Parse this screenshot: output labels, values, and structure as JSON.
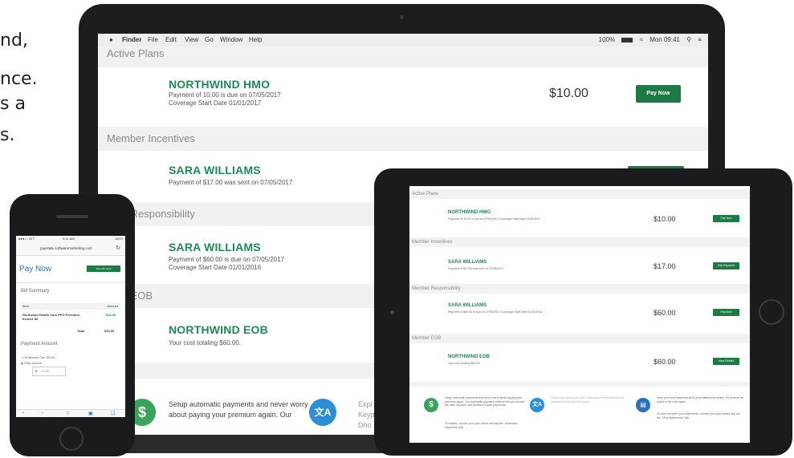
{
  "marketing": {
    "line1": "nd,",
    "line2": "nce.",
    "line3": "s a",
    "line4": "s."
  },
  "colors": {
    "accent": "#1e8a55",
    "button": "#1e7a45",
    "section_bg": "#f1f1f1",
    "device": "#1d1d1f"
  },
  "laptop": {
    "menubar": {
      "apple_icon": "apple-icon",
      "app": "Finder",
      "items": [
        "File",
        "Edit",
        "View",
        "Go",
        "Window",
        "Help"
      ],
      "battery": "100%",
      "clock": "Mon 09:41"
    },
    "sections": {
      "active": "Active Plans",
      "incentives": "Member Incentives",
      "responsibility": "nber Responsibility",
      "eob": "nber EOB"
    },
    "cards": [
      {
        "title": "NORTHWIND HMO",
        "sub1": "Payment of 10.00 is due on 07/05/2017",
        "sub2": "Coverage Start Date 01/01/2017",
        "amount": "$10.00",
        "button": "Pay Now"
      },
      {
        "title": "SARA WILLIAMS",
        "sub1": "Payment of $17.00 was sent on 07/05/2017"
      },
      {
        "title": "SARA WILLIAMS",
        "sub1": "Payment of $60.00 is due on 07/05/2017",
        "sub2": "Coverage Start Date 01/01/2016"
      },
      {
        "title": "NORTHWIND EOB",
        "sub1": "Your cost totaling $60.00."
      }
    ],
    "footer": {
      "text1": "Setup automatic payments and never worry",
      "text2": "about paying your premium again. Our",
      "text3": "Expl",
      "text4": "Keyp",
      "text5": "Dho"
    }
  },
  "phone": {
    "status": {
      "carrier": "●●●○○ ATT",
      "time": "9:41 AM",
      "battery": "100%"
    },
    "url": "paystate.softwaremarketing.com",
    "title": "Pay Now",
    "top_button": "Pay with bank",
    "bill_summary": "Bill Summary",
    "table": {
      "col_item": "Item",
      "col_amount": "Amount",
      "row_item": "Northwind Health Care PPO Premium Invoice 88",
      "row_amount": "$10.00",
      "total_label": "Total",
      "total_value": "$10.00"
    },
    "payment_amount": "Payment Amount",
    "options": [
      "Full Balance Due: $10.00",
      "Other Amount"
    ],
    "input_prefix": "$",
    "input_value": "10.00"
  },
  "tablet": {
    "sections": {
      "active": "Active Plans",
      "incentives": "Member Incentives",
      "responsibility": "Member Responsibility",
      "eob": "Member EOB"
    },
    "rows": [
      {
        "title": "NORTHWIND HMO",
        "sub": "Payment of 10.00 is due on 07/05/2017 Coverage Start Date 01/01/2017",
        "amount": "$10.00",
        "button": "Pay Now"
      },
      {
        "title": "SARA WILLIAMS",
        "sub": "Payment of $17.00 was sent on 07/05/2017",
        "amount": "$17.00",
        "button": "Edit Payment"
      },
      {
        "title": "SARA WILLIAMS",
        "sub": "Payment of $60.00 is due on 07/05/2017 Coverage Start Date 01/01/2016",
        "amount": "$60.00",
        "button": "Pay Now"
      },
      {
        "title": "NORTHWIND EOB",
        "sub": "Your cost totaling $60.00.",
        "amount": "$60.00",
        "button": "View Details"
      }
    ],
    "footer": {
      "col1": "Setup automatic payments and never worry about paying your premium again. Our automatic payment method lets you choose the date, amount, and duration of your payments.",
      "col1b": "To enable, choose your plan above and tap the \"Automatic Payments\" link.",
      "col2": "Learn more about your plan coverage and benefits with our interactive tools and resources.",
      "col3": "View, print and download all of your statements online. You'll never be asked to file mail again.",
      "col3b": "To view and print your statements, choose your plan above and tap the \"View statements\" link."
    }
  }
}
